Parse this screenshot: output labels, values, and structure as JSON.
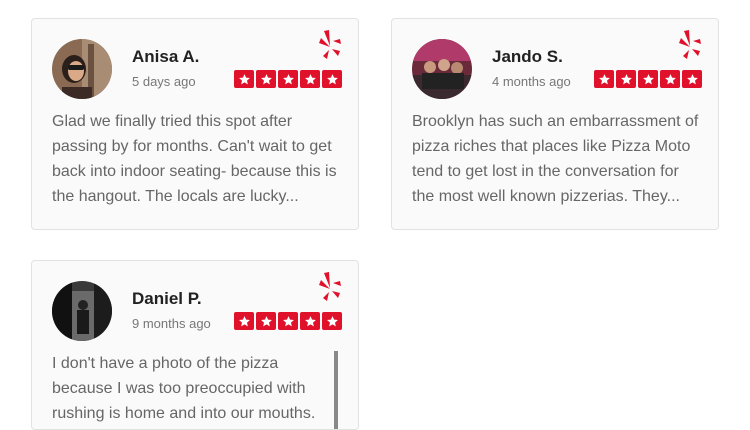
{
  "reviews": [
    {
      "name": "Anisa A.",
      "date": "5 days ago",
      "text": "Glad we finally tried this spot after passing by for months. Can't wait to get back into indoor seating- because this is the hangout. The locals are lucky...",
      "rating": 5,
      "avatar": "woman-selfie-photo"
    },
    {
      "name": "Jando S.",
      "date": "4 months ago",
      "text": "Brooklyn has such an embarrassment of pizza riches that places like Pizza Moto tend to get lost in the conversation for the most well known pizzerias. They...",
      "rating": 5,
      "avatar": "group-photo"
    },
    {
      "name": "Daniel P.",
      "date": "9 months ago",
      "text": "I don't have a photo of the pizza because I was too preoccupied with rushing is home and into our mouths.",
      "rating": 5,
      "avatar": "black-and-white-photo"
    }
  ],
  "colors": {
    "brand_red": "#e0112b",
    "card_bg": "#fafafa",
    "text": "#666666"
  },
  "icons": {
    "source": "yelp-burst-icon",
    "star": "star-icon"
  }
}
